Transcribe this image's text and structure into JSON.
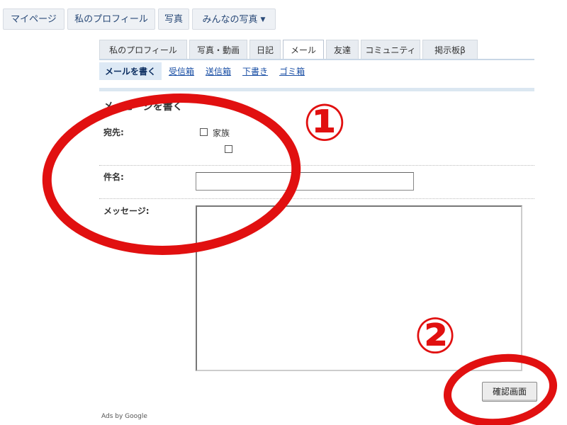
{
  "topnav": {
    "items": [
      "マイページ",
      "私のプロフィール",
      "写真",
      "みんなの写真"
    ]
  },
  "tabs": [
    "私のプロフィール",
    "写真・動画",
    "日記",
    "メール",
    "友達",
    "コミュニティ",
    "掲示板β"
  ],
  "subtabs": [
    "メールを書く",
    "受信箱",
    "送信箱",
    "下書き",
    "ゴミ箱"
  ],
  "form": {
    "section_title": "メッセージを書く",
    "recipient_label": "宛先:",
    "recipient_option": "家族",
    "subject_label": "件名:",
    "subject_value": "",
    "message_label": "メッセージ:",
    "message_value": "",
    "confirm_label": "確認画面"
  },
  "ads": "Ads by Google",
  "annotations": {
    "marker1": "①",
    "marker2": "②",
    "color": "#e11010"
  }
}
